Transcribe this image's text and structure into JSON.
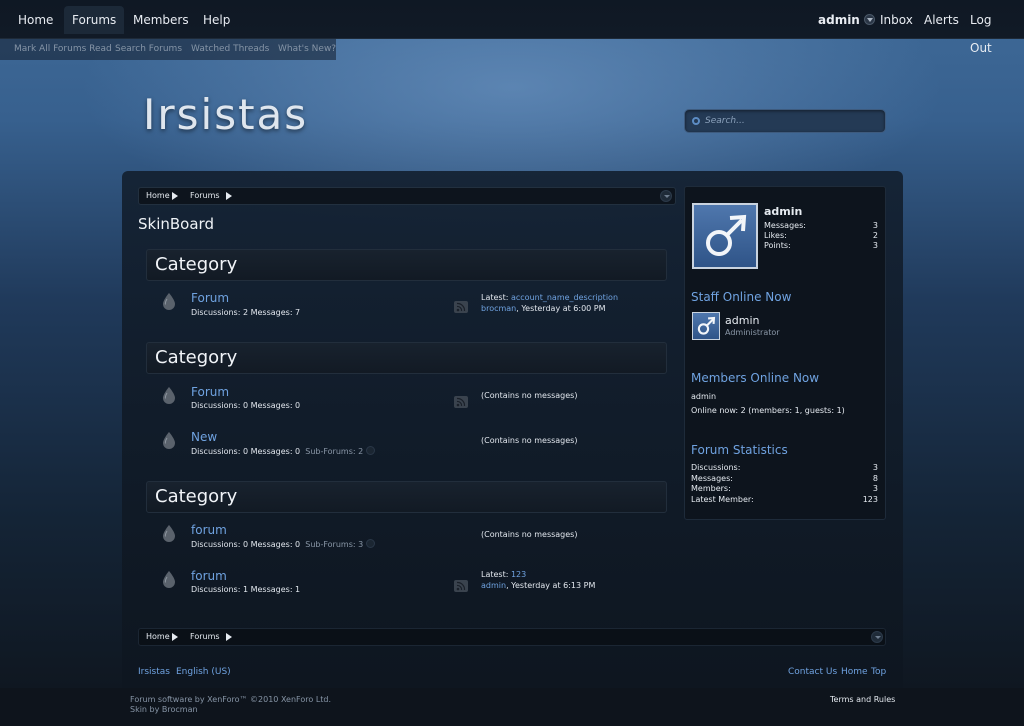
{
  "nav": {
    "tabs": [
      "Home",
      "Forums",
      "Members",
      "Help"
    ],
    "user": "admin",
    "inbox": "Inbox",
    "alerts": "Alerts",
    "logout": "Log Out"
  },
  "subnav": [
    "Mark All Forums Read",
    "Search Forums",
    "Watched Threads",
    "What's New?"
  ],
  "site": {
    "title": "Irsistas"
  },
  "search": {
    "placeholder": "Search..."
  },
  "breadcrumb": [
    "Home",
    "Forums"
  ],
  "page": {
    "title": "SkinBoard"
  },
  "categories": [
    {
      "title": "Category",
      "forums": [
        {
          "name": "Forum",
          "stats": "Discussions: 2 Messages: 7",
          "latest_label": "Latest:",
          "latest_thread": "account_name_description",
          "latest_user": "brocman",
          "latest_time": ", Yesterday at 6:00 PM"
        }
      ]
    },
    {
      "title": "Category",
      "forums": [
        {
          "name": "Forum",
          "stats": "Discussions: 0 Messages: 0",
          "nomsg": "(Contains no messages)"
        },
        {
          "name": "New",
          "stats": "Discussions: 0 Messages: 0",
          "subforums": "Sub-Forums: 2",
          "nomsg": "(Contains no messages)"
        }
      ]
    },
    {
      "title": "Category",
      "forums": [
        {
          "name": "forum",
          "stats": "Discussions: 0 Messages: 0",
          "subforums": "Sub-Forums: 3",
          "nomsg": "(Contains no messages)"
        },
        {
          "name": "forum",
          "stats": "Discussions: 1 Messages: 1",
          "latest_label": "Latest:",
          "latest_thread": "123",
          "latest_user": "admin",
          "latest_time": ", Yesterday at 6:13 PM"
        }
      ]
    }
  ],
  "sidebar": {
    "user": {
      "name": "admin",
      "messages_label": "Messages:",
      "messages": "3",
      "likes_label": "Likes:",
      "likes": "2",
      "points_label": "Points:",
      "points": "3"
    },
    "staff": {
      "title": "Staff Online Now",
      "name": "admin",
      "role": "Administrator"
    },
    "members": {
      "title": "Members Online Now",
      "list": "admin",
      "summary": "Online now: 2 (members: 1, guests: 1)"
    },
    "stats": {
      "title": "Forum Statistics",
      "discussions_label": "Discussions:",
      "discussions": "3",
      "messages_label": "Messages:",
      "messages": "8",
      "members_label": "Members:",
      "members": "3",
      "latest_label": "Latest Member:",
      "latest": "123"
    }
  },
  "footer": {
    "left_links": [
      "Irsistas",
      "English (US)"
    ],
    "right_links": [
      "Contact Us",
      "Home",
      "Top"
    ],
    "copyright": "Forum software by XenForo™ ©2010 XenForo Ltd.",
    "skin": "Skin by Brocman",
    "terms": "Terms and Rules"
  },
  "colors": {
    "accent": "#6fa2e0",
    "panel": "#0d141d",
    "avatar": "#3a64a0"
  }
}
